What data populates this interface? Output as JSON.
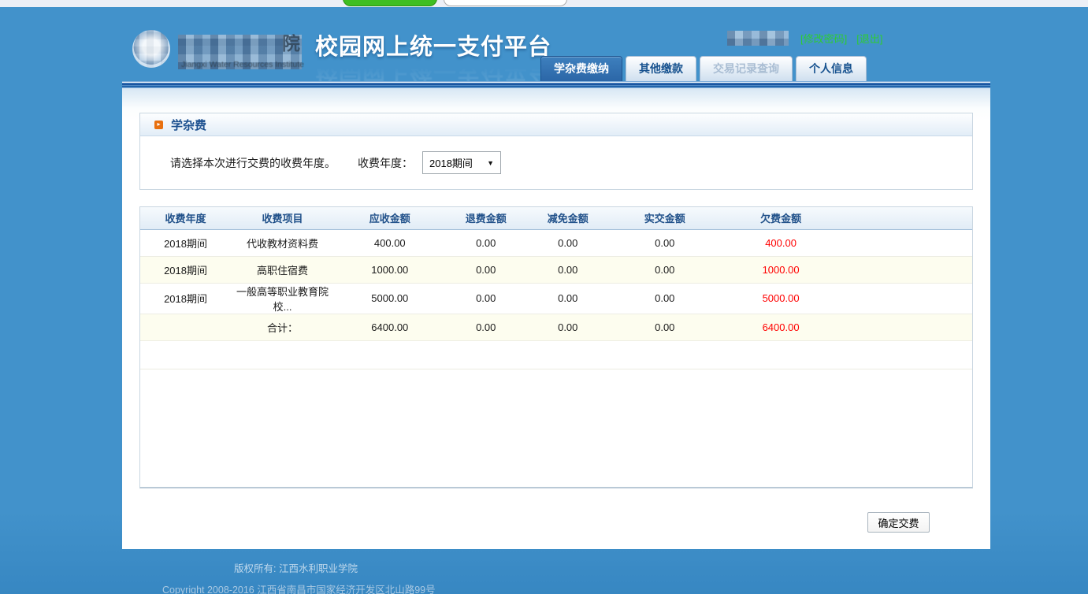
{
  "header": {
    "title": "校园网上统一支付平台",
    "change_password": "[修改密码]",
    "logout": "[退出]"
  },
  "logo": {
    "visible_char": "院",
    "subtitle": "Jiangxi Water Resources Institute"
  },
  "tabs": [
    {
      "label": "学杂费缴纳",
      "state": "active"
    },
    {
      "label": "其他缴款",
      "state": "normal"
    },
    {
      "label": "交易记录查询",
      "state": "disabled"
    },
    {
      "label": "个人信息",
      "state": "normal"
    }
  ],
  "section": {
    "title": "学杂费",
    "instruction": "请选择本次进行交费的收费年度。",
    "year_label": "收费年度：",
    "year_value": "2018期间"
  },
  "table": {
    "headers": [
      "收费年度",
      "收费项目",
      "应收金额",
      "退费金额",
      "减免金额",
      "实交金额",
      "欠费金额"
    ],
    "rows": [
      [
        "2018期间",
        "代收教材资料费",
        "400.00",
        "0.00",
        "0.00",
        "0.00",
        "400.00"
      ],
      [
        "2018期间",
        "高职住宿费",
        "1000.00",
        "0.00",
        "0.00",
        "0.00",
        "1000.00"
      ],
      [
        "2018期间",
        "一般高等职业教育院校...",
        "5000.00",
        "0.00",
        "0.00",
        "0.00",
        "5000.00"
      ]
    ],
    "total": [
      "",
      "合计：",
      "6400.00",
      "0.00",
      "0.00",
      "0.00",
      "6400.00"
    ]
  },
  "confirm_button": "确定交费",
  "footer": {
    "line1": "版权所有: 江西水利职业学院",
    "line2": "Copyright 2008-2016 江西省南昌市国家经济开发区北山路99号"
  },
  "colors": {
    "page_bg": "#4292CB",
    "active_tab_bg": "#2B66A7",
    "link_green": "#2ECC33",
    "owed_red": "#FF0000"
  }
}
